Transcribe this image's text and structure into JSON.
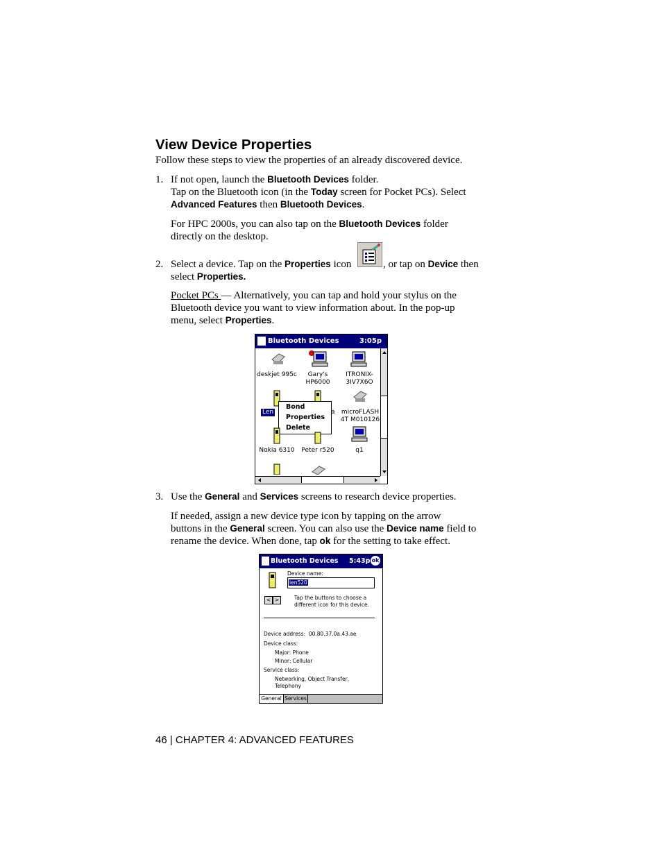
{
  "heading": "View Device Properties",
  "intro": "Follow these steps to view the properties of an already discovered device.",
  "step1": {
    "num": "1.",
    "a1": "If not open, launch the ",
    "a_b": "Bluetooth Devices",
    "a2": " folder.",
    "b1": "Tap on the Bluetooth icon (in the ",
    "b_b": "Today",
    "b2": " screen for Pocket PCs). Select",
    "c_b1": "Advanced Features",
    "c2": " then ",
    "c_b2": "Bluetooth Devices",
    "c3": ".",
    "d1": "For HPC 2000s, you can also tap on the ",
    "d_b": "Bluetooth Devices",
    "d2": " folder",
    "e1": "directly on the desktop."
  },
  "step2": {
    "num": "2.",
    "a1": "Select a device. Tap on the ",
    "a_b": "Properties",
    "a2": " icon",
    "a3": ", or tap on ",
    "a_b2": "Device",
    "a4": " then",
    "b1": "select ",
    "b_b": "Properties.",
    "c_u": "Pocket PCs ",
    "c1": "— Alternatively, you can tap and hold your stylus on the",
    "d1": "Bluetooth device you want to view information about. In the pop-up",
    "e1": "menu, select ",
    "e_b": "Properties",
    "e2": "."
  },
  "screen1": {
    "title": "Bluetooth Devices",
    "time": "3:05p",
    "devices": [
      "deskjet 995c",
      "Gary's",
      "HP6000",
      "ITRONIX-",
      "3IV7X6O",
      "Len",
      "a",
      "microFLASH",
      "4T M010126",
      "Nokia 6310",
      "Peter r520",
      "q1"
    ],
    "menu": [
      "Bond",
      "Properties",
      "Delete"
    ]
  },
  "step3": {
    "num": "3.",
    "a1": "Use the ",
    "a_b1": "General",
    "a2": " and ",
    "a_b2": "Services",
    "a3": " screens to research device properties.",
    "b1": "If needed, assign a new device type icon by tapping on the arrow",
    "c1": "buttons in the ",
    "c_b": "General",
    "c2": " screen. You can also use the ",
    "c_b2": "Device name",
    "c3": " field to",
    "d1": "rename the device. When done, tap ",
    "d_b": "ok",
    "d2": " for the setting to take effect."
  },
  "screen2": {
    "title": "Bluetooth Devices",
    "time": "5:43p",
    "ok": "ok",
    "device_name_label": "Device name:",
    "device_name_value": "len520",
    "hint1": "Tap the buttons to choose a",
    "hint2": "different icon for this device.",
    "address_label": "Device address:",
    "address_value": "00.80.37.0a.43.ae",
    "class_label": "Device class:",
    "major": "Major:  Phone",
    "minor": "Minor:  Cellular",
    "service_label": "Service class:",
    "service1": "Networking, Object Transfer,",
    "service2": "Telephony",
    "tabs": [
      "General",
      "Services"
    ]
  },
  "footer": "46 | CHAPTER 4: ADVANCED FEATURES"
}
